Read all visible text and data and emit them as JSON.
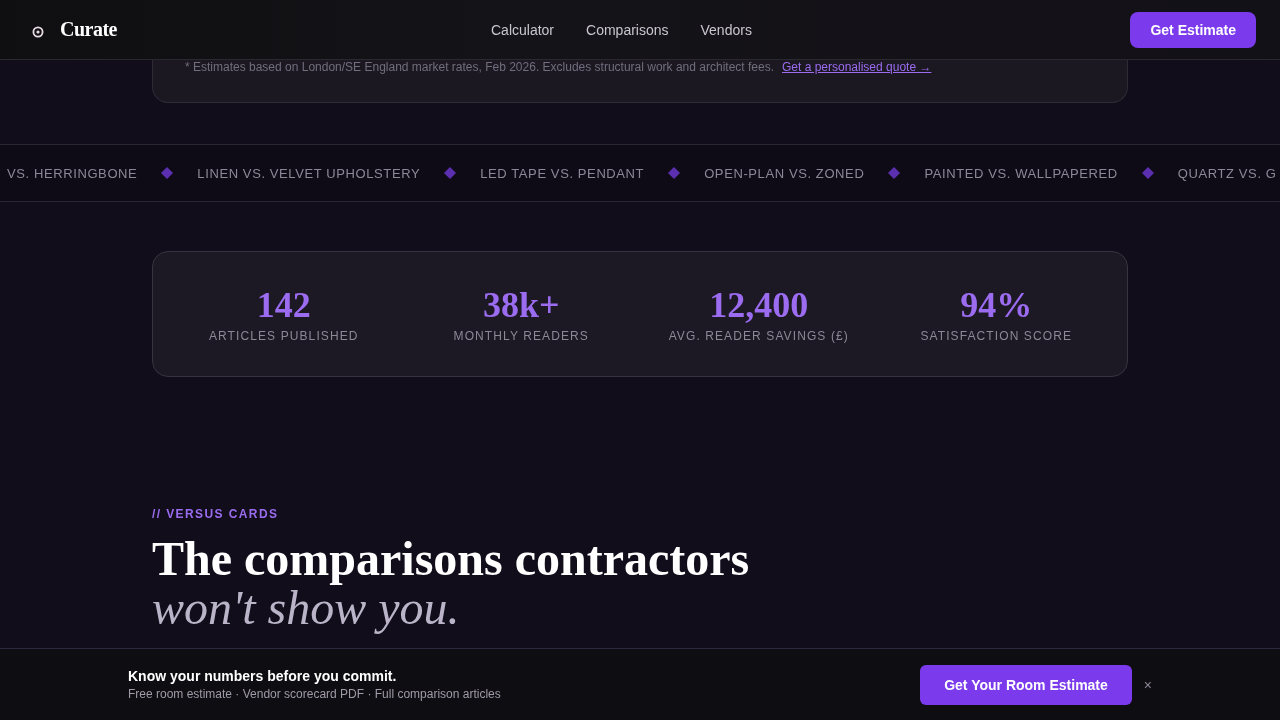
{
  "header": {
    "logo": "Curate",
    "nav": [
      "Calculator",
      "Comparisons",
      "Vendors"
    ],
    "cta": "Get Estimate"
  },
  "estimate_note": {
    "text": "* Estimates based on London/SE England market rates, Feb 2026. Excludes structural work and architect fees.",
    "link": "Get a personalised quote →"
  },
  "ticker": [
    "VS. HERRINGBONE",
    "LINEN VS. VELVET UPHOLSTERY",
    "LED TAPE VS. PENDANT",
    "OPEN-PLAN VS. ZONED",
    "PAINTED VS. WALLPAPERED",
    "QUARTZ VS. G"
  ],
  "stats": [
    {
      "value": "142",
      "label": "ARTICLES PUBLISHED"
    },
    {
      "value": "38k+",
      "label": "MONTHLY READERS"
    },
    {
      "value": "12,400",
      "label": "AVG. READER SAVINGS (£)"
    },
    {
      "value": "94%",
      "label": "SATISFACTION SCORE"
    }
  ],
  "section": {
    "eyebrow": "// VERSUS CARDS",
    "title": "The comparisons contractors",
    "title_italic": "won't show you."
  },
  "bottom_bar": {
    "title": "Know your numbers before you commit.",
    "subtitle": "Free room estimate · Vendor scorecard PDF · Full comparison articles",
    "button": "Get Your Room Estimate",
    "close": "×"
  }
}
